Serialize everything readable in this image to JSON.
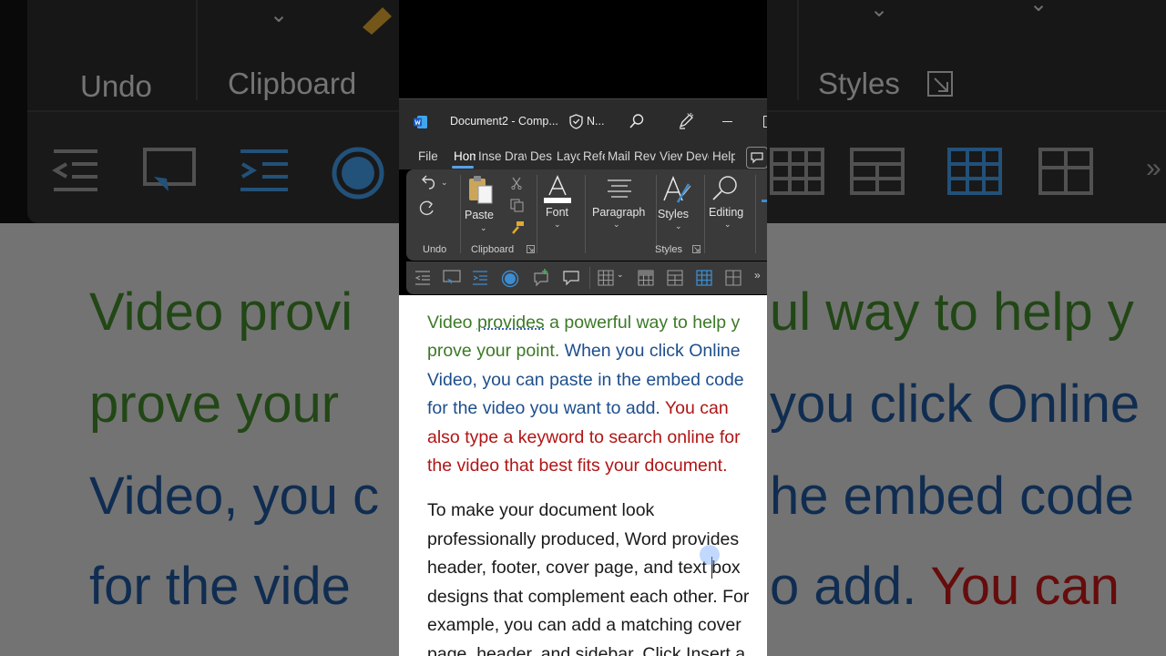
{
  "background": {
    "ribbon_labels": [
      "Undo",
      "Clipboard",
      "Styles"
    ],
    "doc_lines": [
      {
        "parts": [
          {
            "text": "Video provi",
            "color": "green"
          },
          {
            "text": "ul way to help y",
            "color": "green"
          }
        ]
      },
      {
        "parts": [
          {
            "text": "prove your",
            "color": "green"
          },
          {
            "text": "you click Online",
            "color": "blue"
          }
        ]
      },
      {
        "parts": [
          {
            "text": "Video, you c",
            "color": "blue"
          },
          {
            "text": "he embed code",
            "color": "blue"
          }
        ]
      },
      {
        "parts": [
          {
            "text": "for the vide",
            "color": "blue"
          },
          {
            "text": "o add. ",
            "color": "blue"
          },
          {
            "text": "You can",
            "color": "red"
          }
        ]
      }
    ]
  },
  "titlebar": {
    "doc_title": "Document2  -  Comp...",
    "sensitivity_label": "N..."
  },
  "tabs": [
    {
      "label": "File",
      "active": false
    },
    {
      "label": "Hom",
      "active": true
    },
    {
      "label": "Inse",
      "active": false
    },
    {
      "label": "Draw",
      "active": false
    },
    {
      "label": "Desi",
      "active": false
    },
    {
      "label": "Layo",
      "active": false
    },
    {
      "label": "Refe",
      "active": false
    },
    {
      "label": "Mail",
      "active": false
    },
    {
      "label": "Revi",
      "active": false
    },
    {
      "label": "View",
      "active": false
    },
    {
      "label": "Deve",
      "active": false
    },
    {
      "label": "Help",
      "active": false
    }
  ],
  "ribbon": {
    "paste_label": "Paste",
    "font_label": "Font",
    "paragraph_label": "Paragraph",
    "styles_label": "Styles",
    "editing_label": "Editing",
    "group_undo": "Undo",
    "group_clipboard": "Clipboard",
    "group_styles": "Styles"
  },
  "document": {
    "lines": [
      {
        "segs": [
          {
            "t": "Video ",
            "c": "green"
          },
          {
            "t": "provides",
            "c": "green"
          },
          {
            "t": " a powerful way to help y",
            "c": "green"
          }
        ]
      },
      {
        "segs": [
          {
            "t": "prove your point. ",
            "c": "green"
          },
          {
            "t": "When you click Online",
            "c": "blue"
          }
        ]
      },
      {
        "segs": [
          {
            "t": "Video, you can paste in the embed code",
            "c": "blue"
          }
        ]
      },
      {
        "segs": [
          {
            "t": "for the video you want to add. ",
            "c": "blue"
          },
          {
            "t": "You can",
            "c": "red"
          }
        ]
      },
      {
        "segs": [
          {
            "t": "also type a keyword to search online for",
            "c": "red"
          }
        ]
      },
      {
        "segs": [
          {
            "t": "the video that best fits your document.",
            "c": "red"
          }
        ]
      },
      {
        "segs": [
          {
            "t": "To make your document look",
            "c": "black"
          }
        ]
      },
      {
        "segs": [
          {
            "t": "professionally produced, Word provides",
            "c": "black"
          }
        ]
      },
      {
        "segs": [
          {
            "t": "header, footer, cover page, and text box",
            "c": "black"
          }
        ]
      },
      {
        "segs": [
          {
            "t": "designs that complement each other. For",
            "c": "black"
          }
        ]
      },
      {
        "segs": [
          {
            "t": "example, you can add a matching cover",
            "c": "black"
          }
        ]
      },
      {
        "segs": [
          {
            "t": "page, header, and sidebar. Click Insert a",
            "c": "black"
          }
        ]
      }
    ]
  },
  "colors": {
    "green": "#3c7a26",
    "blue": "#1d4e8c",
    "red": "#b01515",
    "accent": "#5aa0e6"
  }
}
